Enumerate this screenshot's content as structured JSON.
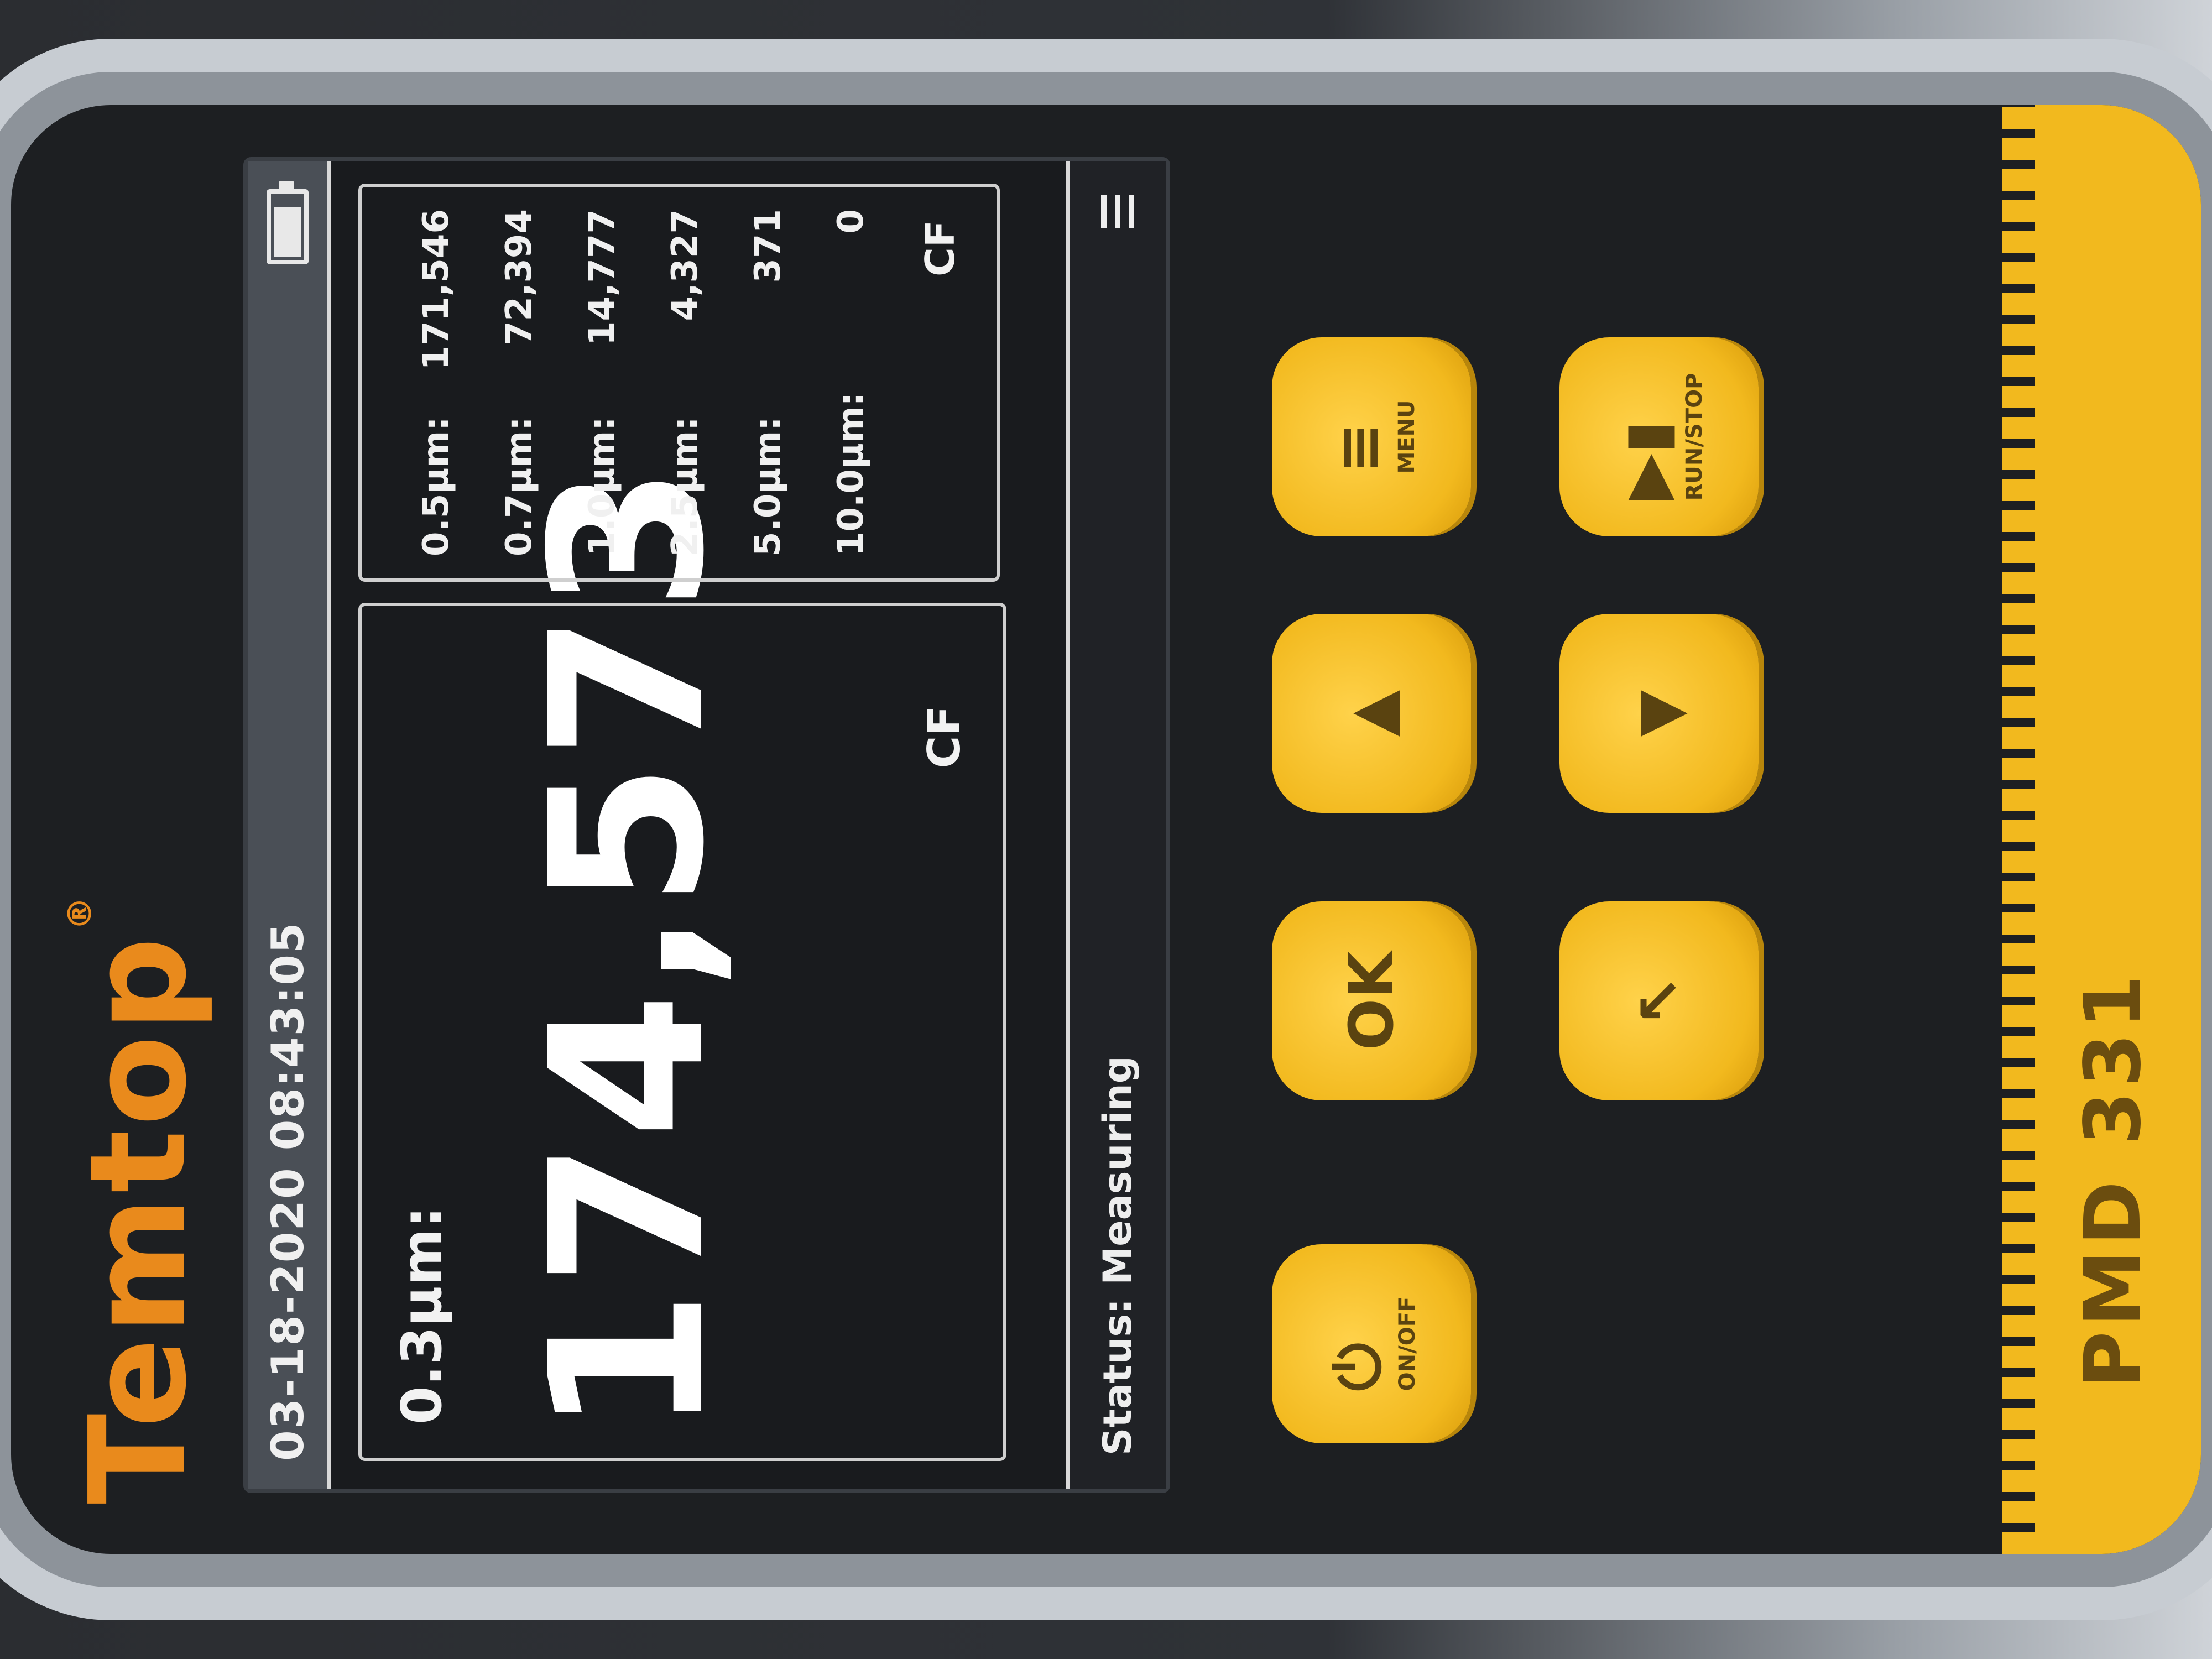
{
  "brand": {
    "name": "Temtop",
    "reg_mark": "®"
  },
  "screen": {
    "datetime": "03-18-2020 08:43:05",
    "main": {
      "size_label": "0.3μm:",
      "value": "174,573",
      "unit": "CF"
    },
    "side_rows": [
      {
        "size": "0.5μm:",
        "value": "171,546"
      },
      {
        "size": "0.7μm:",
        "value": "72,394"
      },
      {
        "size": "1.0μm:",
        "value": "14,777"
      },
      {
        "size": "2.5μm:",
        "value": "4,327"
      },
      {
        "size": "5.0μm:",
        "value": "371"
      },
      {
        "size": "10.0μm:",
        "value": "0"
      }
    ],
    "side_unit": "CF",
    "status": "Status: Measuring"
  },
  "keys": {
    "power": {
      "label": "⏻",
      "sub": "ON/OFF"
    },
    "ok": {
      "label": "OK"
    },
    "up": {
      "label": "▲"
    },
    "menu": {
      "label": "≡",
      "sub": "MENU"
    },
    "back": {
      "label": "↖"
    },
    "down": {
      "label": "▼"
    },
    "play": {
      "label": "▶▮",
      "sub": "RUN/STOP"
    }
  },
  "model": "PMD 331",
  "colors": {
    "brand_orange": "#e98a1c",
    "button_yellow": "#f2b91e",
    "screen_bg": "#191b1e"
  }
}
